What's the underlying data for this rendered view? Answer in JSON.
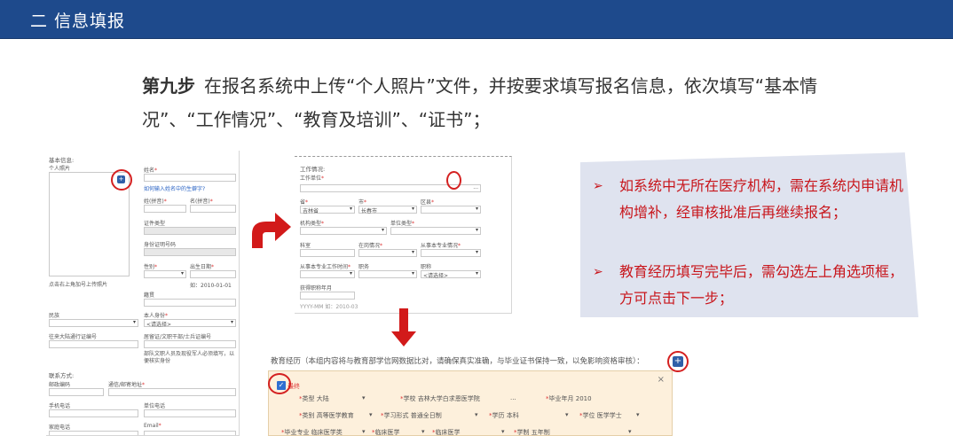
{
  "header": {
    "title": "二  信息填报"
  },
  "step": {
    "label": "第九步",
    "text": "在报名系统中上传“个人照片”文件，并按要求填写报名信息，依次填写“基本情况”、“工作情况”、“教育及培训”、“证书”；"
  },
  "form_basic": {
    "section_title": "基本信息:",
    "photo_label": "个人照片",
    "photo_hint": "点击右上角加号上传照片",
    "name_label": "姓名",
    "name_link": "如何输入姓名中的生僻字?",
    "pinyin_last_label": "姓(拼音)",
    "pinyin_first_label": "名(拼音)",
    "id_type_label": "证件类型",
    "id_number_label": "身份证明号码",
    "gender_label": "性别",
    "birth_label": "出生日期",
    "birth_hint": "如：2010-01-01",
    "native_label": "籍贯",
    "ethnicity_label": "民族",
    "identity_label": "本人身份",
    "identity_value": "<请选择>",
    "hmt_label": "往来大陆通行证编号",
    "residence_label": "居留证/文职干部/士兵证编号",
    "residence_hint": "部队文职人员及现役军人必须填写，以便核实身份",
    "contact_title": "联系方式:",
    "postcode_label": "邮政编码",
    "address_label": "通信/邮寄地址",
    "mobile_label": "手机电话",
    "work_phone_label": "单位电话",
    "home_phone_label": "家庭电话",
    "email_label": "Email"
  },
  "form_work": {
    "section_title": "工作情况:",
    "org_label": "工作单位",
    "province_label": "省",
    "province_value": "吉林省",
    "city_label": "市",
    "city_value": "长春市",
    "district_label": "区县",
    "org_type_label": "机构类型",
    "org_level_label": "单位类型",
    "dept_label": "科室",
    "staff_label": "在岗情况",
    "specialty_label": "从事本专业情况",
    "work_time_label": "从事本专业工作时间",
    "post_label": "职务",
    "title_label": "职称",
    "title_value": "<请选择>",
    "title_date_label": "获得职称年月",
    "title_date_hint": "YYYY-MM 如：2010-03"
  },
  "notes": [
    "如系统中无所在医疗机构，需在系统内申请机构增补，经审核批准后再继续报名；",
    "教育经历填写完毕后，需勾选左上角选项框，方可点击下一步；"
  ],
  "education": {
    "title": "教育经历（本组内容将与教育部学信网数据比对，请确保真实准确，与毕业证书保持一致，以免影响资格审核）：",
    "checkbox_label": "最终",
    "type_label": "类型",
    "type_value": "大陆",
    "school_label": "学校",
    "school_value": "吉林大学白求恩医学院",
    "grad_label": "毕业年月",
    "grad_value": "2010",
    "category_label": "类别",
    "category_value": "高等医学教育",
    "mode_label": "学习形式",
    "mode_value": "普通全日制",
    "degree_label": "学历",
    "degree_value": "本科",
    "bachelor_label": "学位",
    "bachelor_value": "医学学士",
    "major_label": "毕业专业",
    "major_value": "临床医学类",
    "major2_value": "临床医学",
    "major3_value": "临床医学",
    "length_label": "学制",
    "length_value": "五年制"
  },
  "icons": {
    "plus": "plus-icon",
    "close": "close-icon",
    "arrow_curved": "curved-arrow-icon",
    "arrow_down": "down-arrow-icon",
    "bullet": "triangle-bullet-icon",
    "check": "check-icon"
  },
  "colors": {
    "header_bg": "#1e4a8c",
    "accent_red": "#c8151b",
    "note_bg": "#dfe3ef",
    "edu_bg": "#fdf0dc"
  },
  "symbols": {
    "plus": "+",
    "close": "×",
    "check": "✓",
    "bullet": "➢",
    "dots": "..."
  }
}
